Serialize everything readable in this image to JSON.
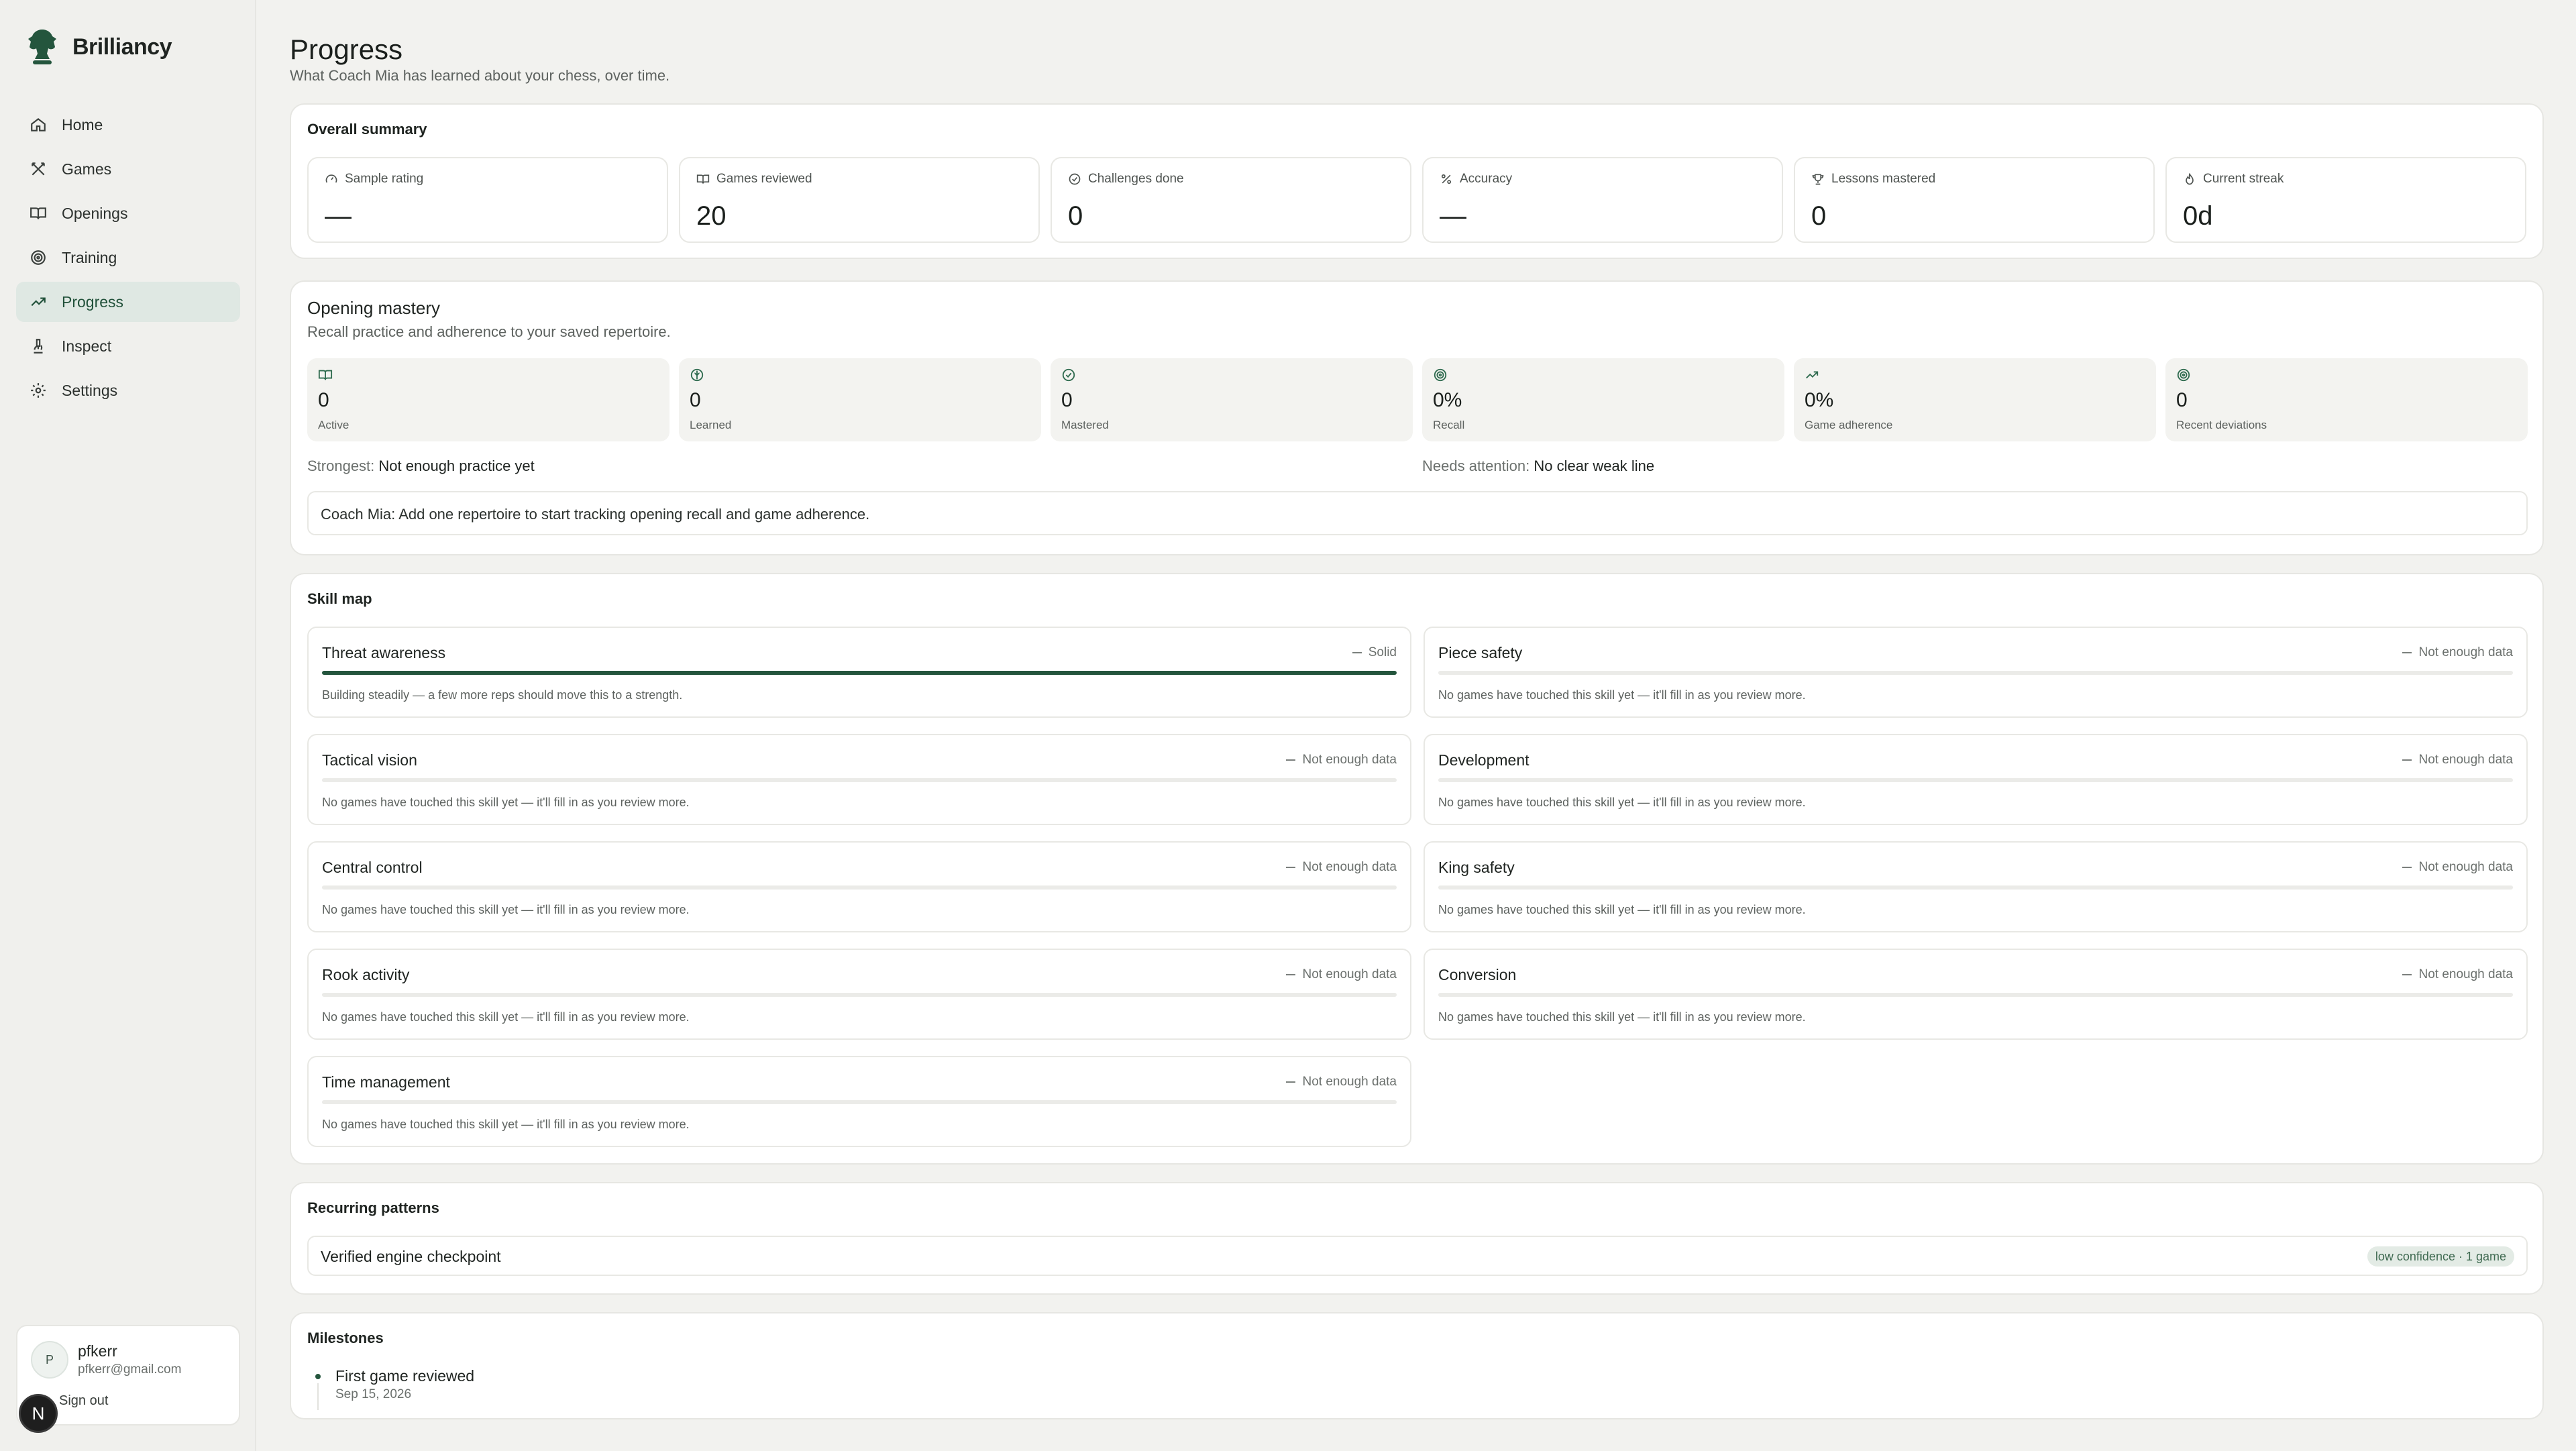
{
  "app": {
    "name": "Brilliancy",
    "accent": "#24553d"
  },
  "nav": {
    "items": [
      {
        "label": "Home",
        "icon": "home-icon"
      },
      {
        "label": "Games",
        "icon": "crossed-swords-icon"
      },
      {
        "label": "Openings",
        "icon": "book-open-icon"
      },
      {
        "label": "Training",
        "icon": "target-icon"
      },
      {
        "label": "Progress",
        "icon": "trending-up-icon",
        "active": true
      },
      {
        "label": "Inspect",
        "icon": "microscope-icon"
      },
      {
        "label": "Settings",
        "icon": "gear-icon"
      }
    ]
  },
  "user": {
    "initial": "P",
    "name": "pfkerr",
    "email": "pfkerr@gmail.com",
    "signout": "Sign out",
    "badge": "N"
  },
  "page": {
    "title": "Progress",
    "subtitle": "What Coach Mia has learned about your chess, over time."
  },
  "summary": {
    "title": "Overall summary",
    "stats": [
      {
        "label": "Sample rating",
        "value": "—",
        "icon": "gauge-icon"
      },
      {
        "label": "Games reviewed",
        "value": "20",
        "icon": "book-icon"
      },
      {
        "label": "Challenges done",
        "value": "0",
        "icon": "check-circle-icon"
      },
      {
        "label": "Accuracy",
        "value": "—",
        "icon": "percent-icon"
      },
      {
        "label": "Lessons mastered",
        "value": "0",
        "icon": "trophy-icon"
      },
      {
        "label": "Current streak",
        "value": "0d",
        "icon": "flame-icon"
      }
    ]
  },
  "mastery": {
    "title": "Opening mastery",
    "subtitle": "Recall practice and adherence to your saved repertoire.",
    "tiles": [
      {
        "value": "0",
        "label": "Active",
        "icon": "book-icon"
      },
      {
        "value": "0",
        "label": "Learned",
        "icon": "brain-icon"
      },
      {
        "value": "0",
        "label": "Mastered",
        "icon": "check-circle-icon"
      },
      {
        "value": "0%",
        "label": "Recall",
        "icon": "target-icon"
      },
      {
        "value": "0%",
        "label": "Game adherence",
        "icon": "trending-up-icon"
      },
      {
        "value": "0",
        "label": "Recent deviations",
        "icon": "target-icon"
      }
    ],
    "strongest_label": "Strongest:",
    "strongest_value": "Not enough practice yet",
    "attention_label": "Needs attention:",
    "attention_value": "No clear weak line",
    "coach_label": "Coach Mia:",
    "coach_text": "Add one repertoire to start tracking opening recall and game adherence."
  },
  "skillmap": {
    "title": "Skill map",
    "skills": [
      {
        "name": "Threat awareness",
        "status": "Solid",
        "level": 1.0,
        "desc": "Building steadily — a few more reps should move this to a strength."
      },
      {
        "name": "Piece safety",
        "status": "Not enough data",
        "level": 0,
        "desc": "No games have touched this skill yet — it'll fill in as you review more."
      },
      {
        "name": "Tactical vision",
        "status": "Not enough data",
        "level": 0,
        "desc": "No games have touched this skill yet — it'll fill in as you review more."
      },
      {
        "name": "Development",
        "status": "Not enough data",
        "level": 0,
        "desc": "No games have touched this skill yet — it'll fill in as you review more."
      },
      {
        "name": "Central control",
        "status": "Not enough data",
        "level": 0,
        "desc": "No games have touched this skill yet — it'll fill in as you review more."
      },
      {
        "name": "King safety",
        "status": "Not enough data",
        "level": 0,
        "desc": "No games have touched this skill yet — it'll fill in as you review more."
      },
      {
        "name": "Rook activity",
        "status": "Not enough data",
        "level": 0,
        "desc": "No games have touched this skill yet — it'll fill in as you review more."
      },
      {
        "name": "Conversion",
        "status": "Not enough data",
        "level": 0,
        "desc": "No games have touched this skill yet — it'll fill in as you review more."
      },
      {
        "name": "Time management",
        "status": "Not enough data",
        "level": 0,
        "desc": "No games have touched this skill yet — it'll fill in as you review more."
      }
    ]
  },
  "recurring": {
    "title": "Recurring patterns",
    "items": [
      {
        "name": "Verified engine checkpoint",
        "badge": "low confidence · 1 game"
      }
    ]
  },
  "milestones": {
    "title": "Milestones",
    "items": [
      {
        "title": "First game reviewed",
        "date": "Sep 15, 2026"
      }
    ]
  }
}
